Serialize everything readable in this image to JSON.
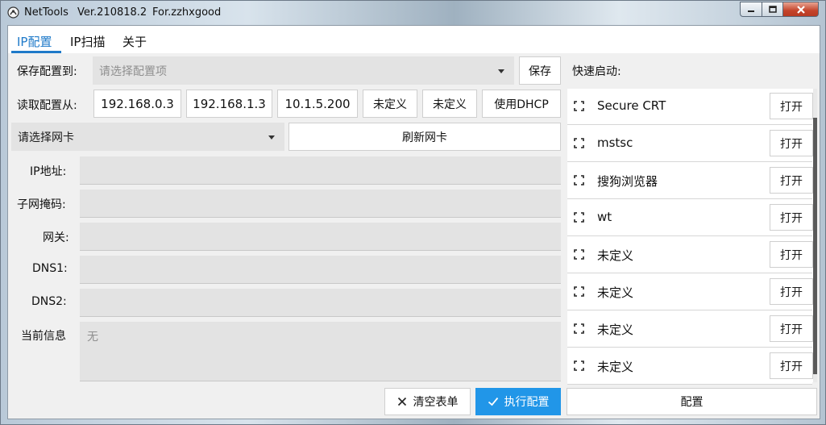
{
  "window": {
    "app_name": "NetTools",
    "version": "Ver.210818.2",
    "for_text": "For.zzhxgood"
  },
  "tabs": [
    {
      "label": "IP配置",
      "active": true
    },
    {
      "label": "IP扫描",
      "active": false
    },
    {
      "label": "关于",
      "active": false
    }
  ],
  "save_config": {
    "label": "保存配置到:",
    "select_placeholder": "请选择配置项",
    "save_button": "保存"
  },
  "read_config": {
    "label": "读取配置从:",
    "presets": [
      "192.168.0.3",
      "192.168.1.3",
      "10.1.5.200",
      "未定义",
      "未定义",
      "使用DHCP"
    ]
  },
  "nic": {
    "select_label": "请选择网卡",
    "refresh_button": "刷新网卡"
  },
  "form": {
    "ip_label": "IP地址:",
    "mask_label": "子网掩码:",
    "gateway_label": "网关:",
    "dns1_label": "DNS1:",
    "dns2_label": "DNS2:",
    "info_label": "当前信息",
    "info_value": "无"
  },
  "actions": {
    "clear_button": "清空表单",
    "apply_button": "执行配置",
    "config_button": "配置"
  },
  "quick_launch": {
    "title": "快速启动:",
    "open_label": "打开",
    "items": [
      "Secure CRT",
      "mstsc",
      "搜狗浏览器",
      "wt",
      "未定义",
      "未定义",
      "未定义",
      "未定义"
    ]
  },
  "colors": {
    "accent": "#1f7ac9",
    "apply_button_bg": "#2196e8",
    "field_bg": "#e3e3e3",
    "close_button": "#c4442b"
  }
}
